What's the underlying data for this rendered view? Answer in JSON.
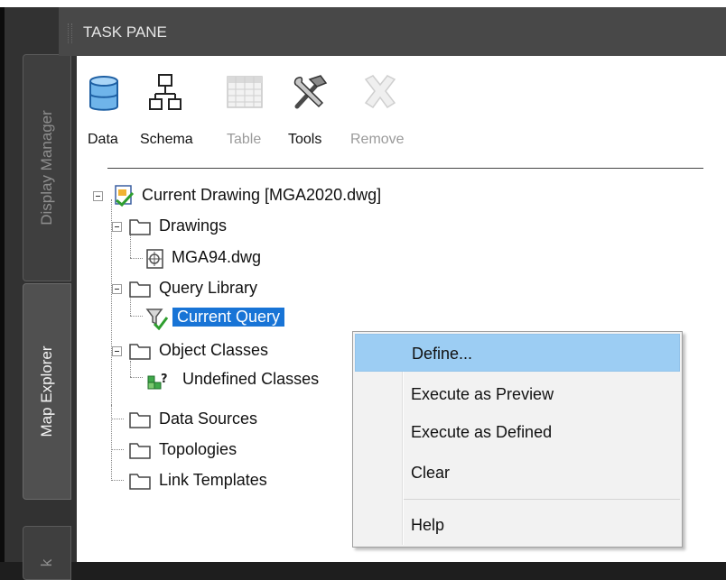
{
  "panel": {
    "title": "TASK PANE"
  },
  "sidebar_tabs": [
    {
      "label": "Display Manager"
    },
    {
      "label": "Map Explorer"
    },
    {
      "label": "k"
    }
  ],
  "toolbar": {
    "buttons": [
      {
        "label": "Data",
        "icon": "database-icon"
      },
      {
        "label": "Schema",
        "icon": "schema-icon"
      },
      {
        "label": "Table",
        "icon": "table-icon"
      },
      {
        "label": "Tools",
        "icon": "tools-icon"
      },
      {
        "label": "Remove",
        "icon": "remove-icon"
      }
    ]
  },
  "tree": {
    "root": "Current Drawing [MGA2020.dwg]",
    "drawings": "Drawings",
    "drawing_file": "MGA94.dwg",
    "query_library": "Query Library",
    "current_query": "Current Query",
    "object_classes": "Object Classes",
    "undefined_classes": "Undefined Classes",
    "data_sources": "Data Sources",
    "topologies": "Topologies",
    "link_templates": "Link Templates"
  },
  "context_menu": {
    "items": [
      {
        "label": "Define..."
      },
      {
        "label": "Execute as Preview"
      },
      {
        "label": "Execute as Defined"
      },
      {
        "label": "Clear"
      },
      {
        "label": "Help"
      }
    ]
  },
  "colors": {
    "selection": "#1874d6",
    "menu_highlight": "#9ccdf3",
    "header": "#484848",
    "sidebar": "#323232"
  }
}
